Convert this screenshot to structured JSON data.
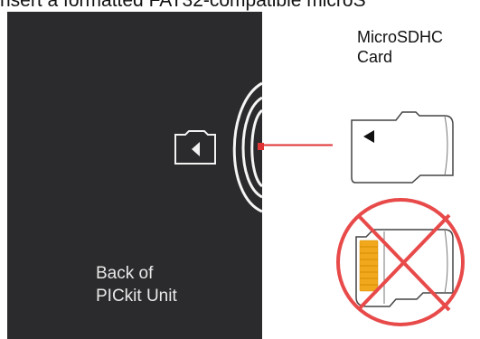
{
  "caption": "nsert a formatted FAT32-compatible microS",
  "unit_label": {
    "line1": "Back of",
    "line2": "PICkit Unit"
  },
  "card_label": {
    "line1": "MicroSDHC",
    "line2": "Card"
  },
  "icons": [
    "sd-card-icon",
    "slot-arrow-icon",
    "prohibited-icon"
  ],
  "colors": {
    "unit_background": "#2b2b2d",
    "pointer_red": "#e03434",
    "prohibited_red": "#e84a4a",
    "card_outline": "#444444",
    "contacts_orange": "#f2a81d"
  }
}
